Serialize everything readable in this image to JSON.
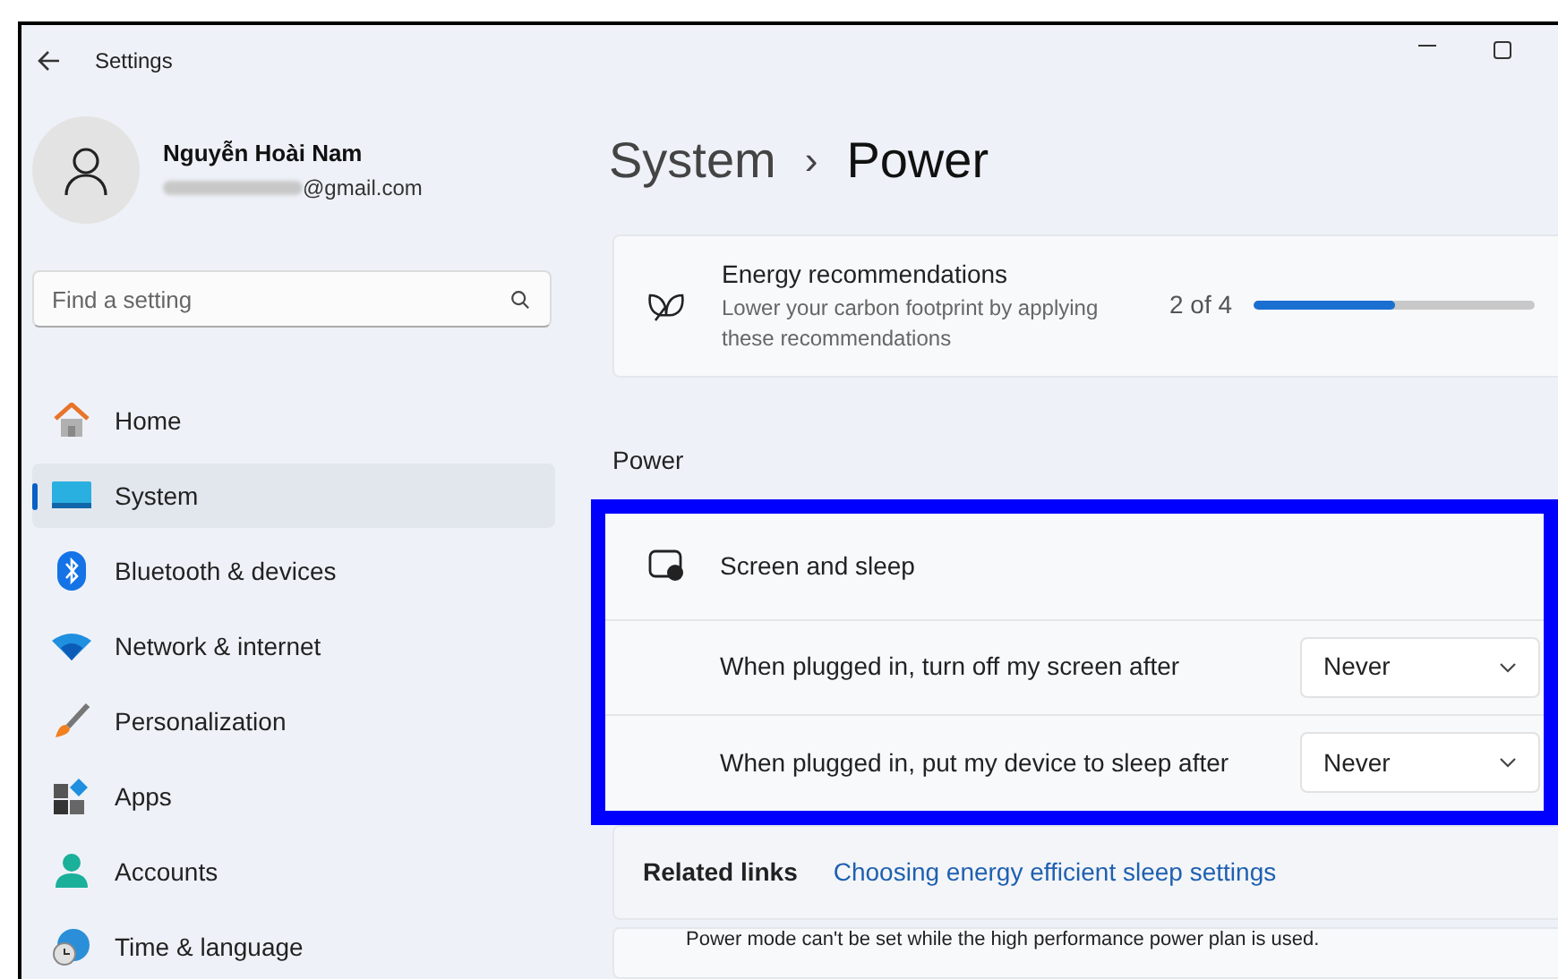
{
  "window": {
    "title": "Settings"
  },
  "profile": {
    "name": "Nguyễn Hoài Nam",
    "email": "@gmail.com"
  },
  "search": {
    "placeholder": "Find a setting"
  },
  "nav": [
    {
      "label": "Home",
      "selected": false
    },
    {
      "label": "System",
      "selected": true
    },
    {
      "label": "Bluetooth & devices",
      "selected": false
    },
    {
      "label": "Network & internet",
      "selected": false
    },
    {
      "label": "Personalization",
      "selected": false
    },
    {
      "label": "Apps",
      "selected": false
    },
    {
      "label": "Accounts",
      "selected": false
    },
    {
      "label": "Time & language",
      "selected": false
    }
  ],
  "breadcrumb": {
    "parent": "System",
    "separator": "›",
    "current": "Power"
  },
  "energy": {
    "title": "Energy recommendations",
    "description": "Lower your carbon footprint by applying these recommendations",
    "count": "2 of 4",
    "level": 0.5
  },
  "section": "Power",
  "screen_sleep": {
    "title": "Screen and sleep",
    "rows": [
      {
        "label": "When plugged in, turn off my screen after",
        "value": "Never"
      },
      {
        "label": "When plugged in, put my device to sleep after",
        "value": "Never"
      }
    ]
  },
  "related": {
    "label": "Related links",
    "link": "Choosing energy efficient sleep settings"
  },
  "notice": "Power mode can't be set while the high performance power plan is used."
}
